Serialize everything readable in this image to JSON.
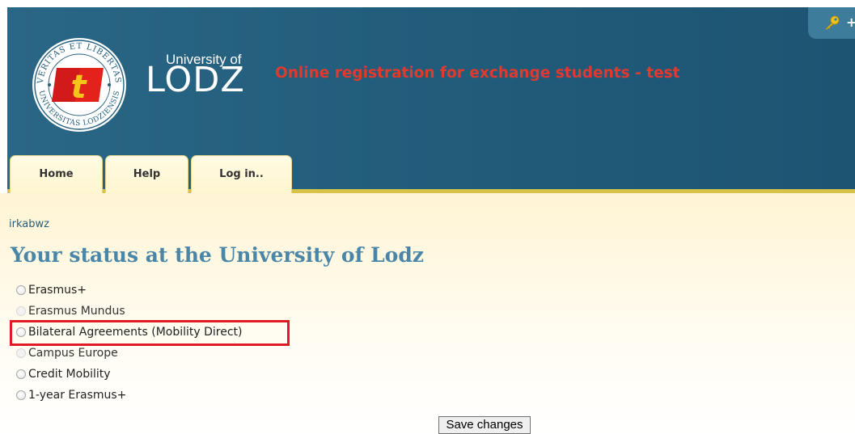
{
  "header": {
    "seal_text_top": "VERITAS ET LIBERTAS",
    "seal_text_bottom": "UNIVERSITAS LODZIENSIS",
    "seal_letter": "t",
    "logo_university": "University of",
    "logo_lodz": "LODZ",
    "site_title": "Online registration for exchange students - test",
    "key_tab_plus": "+"
  },
  "tabs": [
    {
      "label": "Home"
    },
    {
      "label": "Help"
    },
    {
      "label": "Log in.."
    }
  ],
  "main": {
    "username": "irkabwz",
    "title": "Your status at the University of Lodz",
    "options": [
      {
        "label": "Erasmus+",
        "enabled": true
      },
      {
        "label": "Erasmus Mundus",
        "enabled": false
      },
      {
        "label": "Bilateral Agreements (Mobility Direct)",
        "enabled": true,
        "highlighted": true
      },
      {
        "label": "Campus Europe",
        "enabled": false
      },
      {
        "label": "Credit Mobility",
        "enabled": true
      },
      {
        "label": "1-year Erasmus+",
        "enabled": true
      }
    ],
    "save_label": "Save changes"
  },
  "colors": {
    "header_bg": "#245f7e",
    "title_red": "#e03a2f",
    "tab_bg": "#fff8dc",
    "accent_yellow": "#d7c24a",
    "page_title_blue": "#4a86a7",
    "highlight_red": "#e01b24"
  },
  "icons": {
    "key": "key-icon",
    "seal": "university-seal-icon"
  }
}
